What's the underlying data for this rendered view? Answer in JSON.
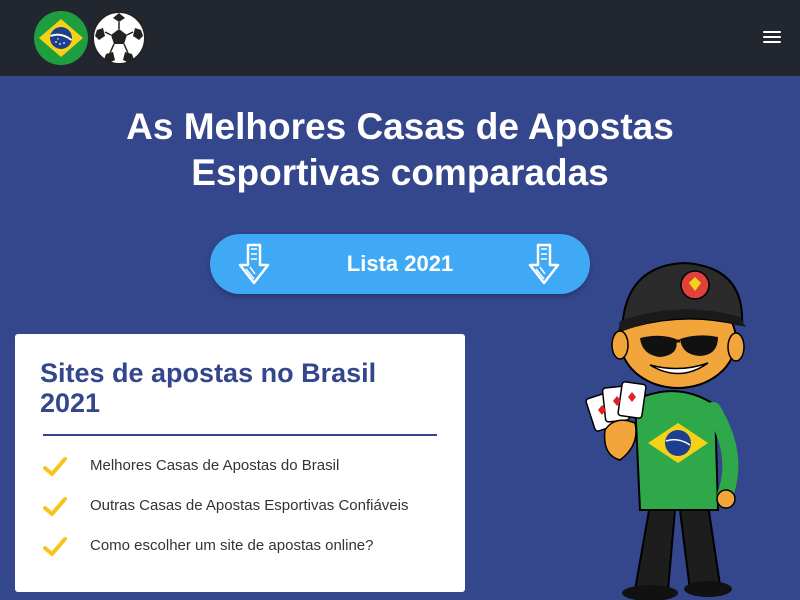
{
  "header": {
    "logo_icons": [
      "brazil-flag-icon",
      "soccer-ball-icon"
    ],
    "menu_icon": "hamburger-menu-icon"
  },
  "hero": {
    "title_line1": "As Melhores Casas de Apostas",
    "title_line2": "Esportivas comparadas",
    "cta_label": "Lista 2021",
    "cta_icon": "down-arrow-icon"
  },
  "toc": {
    "title": "Sites de apostas no Brasil 2021",
    "items": [
      {
        "label": "Melhores Casas de Apostas do Brasil",
        "icon": "checkmark-icon"
      },
      {
        "label": "Outras Casas de Apostas Esportivas Confiáveis",
        "icon": "checkmark-icon"
      },
      {
        "label": "Como escolher um site de apostas online?",
        "icon": "checkmark-icon"
      }
    ]
  },
  "mascot": {
    "icon": "mascot-illustration"
  },
  "colors": {
    "header_bg": "#22262e",
    "page_bg": "#34468c",
    "cta_bg": "#3fa9f5",
    "check": "#f5c518",
    "heading": "#34468c"
  }
}
